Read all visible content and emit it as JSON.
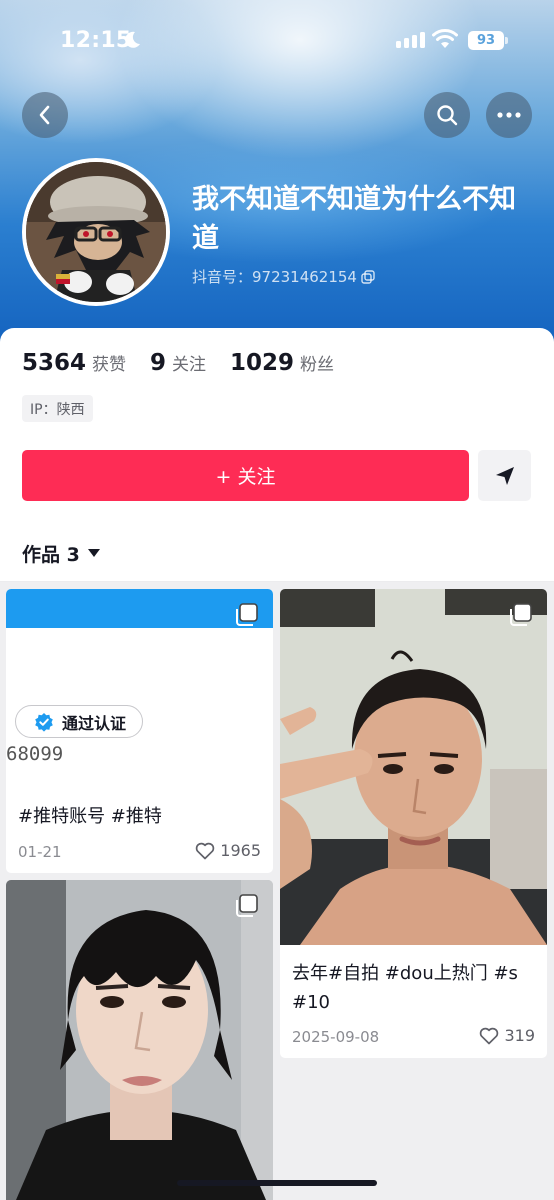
{
  "status_bar": {
    "time": "12:15",
    "battery": "93"
  },
  "profile": {
    "nickname": "我不知道不知道为什么不知道",
    "douyin_id": "抖音号：97231462154",
    "ip": "IP：陕西"
  },
  "stats": [
    {
      "value": "5364",
      "label": "获赞"
    },
    {
      "value": "9",
      "label": "关注"
    },
    {
      "value": "1029",
      "label": "粉丝"
    }
  ],
  "actions": {
    "follow_label": "+ 关注"
  },
  "works_tab": {
    "label": "作品 3"
  },
  "posts": [
    {
      "verify_label": "通过认证",
      "screen_number": "68099",
      "caption": "#推特账号 #推特",
      "date": "01-21",
      "likes": "1965"
    },
    {
      "caption": "去年#自拍 #dou上热门 #s #10",
      "date": "2025-09-08",
      "likes": "319"
    },
    {}
  ],
  "colors": {
    "accent": "#fe2c55",
    "banner_blue": "#1463bf"
  }
}
